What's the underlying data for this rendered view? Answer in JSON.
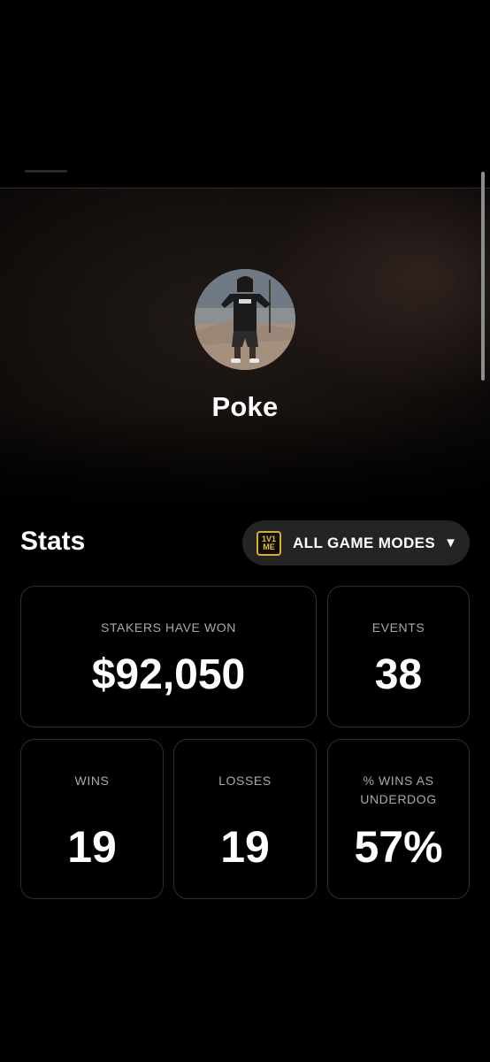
{
  "profile": {
    "name": "Poke"
  },
  "stats": {
    "title": "Stats",
    "game_mode": {
      "logo_top": "1V1",
      "logo_bottom": "ME",
      "label": "ALL GAME MODES",
      "caret": "▼"
    },
    "cards": {
      "stakers_won": {
        "label": "STAKERS HAVE WON",
        "value": "$92,050"
      },
      "events": {
        "label": "EVENTS",
        "value": "38"
      },
      "wins": {
        "label": "WINS",
        "value": "19"
      },
      "losses": {
        "label": "LOSSES",
        "value": "19"
      },
      "underdog": {
        "label": "% WINS AS UNDERDOG",
        "value": "57%"
      }
    }
  },
  "colors": {
    "background": "#000000",
    "card_border": "#2e2e2e",
    "mode_button": "#242424",
    "logo_accent": "#d8b024",
    "label_gray": "#a9a9a9"
  }
}
